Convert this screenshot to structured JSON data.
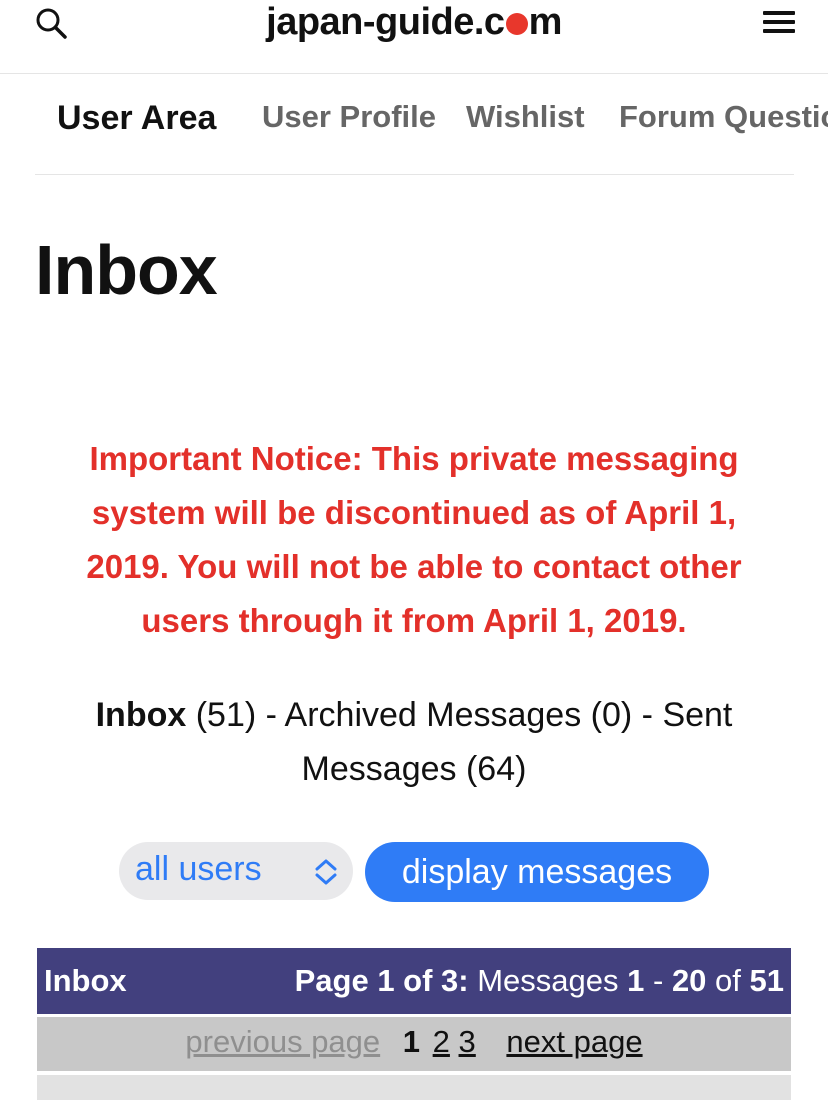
{
  "header": {
    "logo_pre": "japan-guide.c",
    "logo_post": "m",
    "search_icon": "search-icon",
    "menu_icon": "hamburger-menu-icon"
  },
  "tabs": [
    {
      "label": "User Area",
      "active": true
    },
    {
      "label": "User Profile",
      "active": false
    },
    {
      "label": "Wishlist",
      "active": false
    },
    {
      "label": "Forum Questions",
      "active": false
    }
  ],
  "page": {
    "title": "Inbox"
  },
  "notice": {
    "text": "Important Notice: This private messaging system will be discontinued as of April 1, 2019. You will not be able to contact other users through it from April 1, 2019.",
    "color": "#e3302a"
  },
  "folders": {
    "inbox_label": "Inbox",
    "inbox_count": " (51) - ",
    "archived_label": "Archived Messages",
    "archived_count": " (0) - ",
    "sent_label": "Sent Messages",
    "sent_count": " (64)"
  },
  "controls": {
    "select_value": "all users",
    "display_button": "display messages",
    "accent": "#2f7cf6"
  },
  "table": {
    "header_left": "Inbox",
    "page_label": "Page 1 of 3:",
    "messages_word": " Messages ",
    "range_start": "1",
    "range_sep": " - ",
    "range_end": "20",
    "of_word": " of ",
    "total": "51",
    "header_color": "#42407e"
  },
  "pager": {
    "previous": "previous page",
    "current": "1",
    "pages": [
      "2",
      "3"
    ],
    "next": "next page"
  }
}
